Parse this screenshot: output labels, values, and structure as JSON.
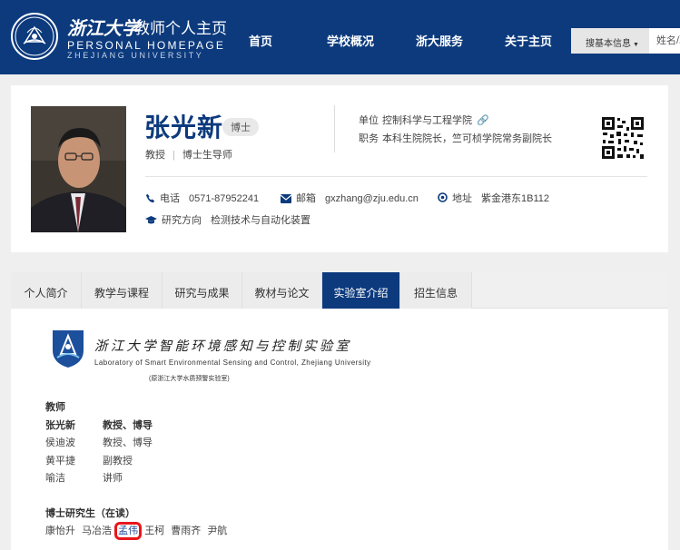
{
  "header": {
    "logo_cn": "浙江大学",
    "logo_title": "教师个人主页",
    "logo_en1": "PERSONAL HOMEPAGE",
    "logo_en2": "ZHEJIANG UNIVERSITY",
    "nav": [
      "首页",
      "学校概况",
      "浙大服务",
      "关于主页"
    ],
    "search_select": "搜基本信息",
    "search_placeholder": "姓名/职"
  },
  "profile": {
    "name": "张光新",
    "degree": "博士",
    "title": "教授",
    "supervisor": "博士生导师",
    "org_label": "单位",
    "org_value": "控制科学与工程学院",
    "duty_label": "职务",
    "duty_value": "本科生院院长，竺可桢学院常务副院长",
    "phone_label": "电话",
    "phone_value": "0571-87952241",
    "email_label": "邮箱",
    "email_value": "gxzhang@zju.edu.cn",
    "addr_label": "地址",
    "addr_value": "紫金港东1B112",
    "research_label": "研究方向",
    "research_value": "检测技术与自动化装置"
  },
  "tabs": [
    "个人简介",
    "教学与课程",
    "研究与成果",
    "教材与论文",
    "实验室介绍",
    "招生信息"
  ],
  "active_tab": "实验室介绍",
  "lab": {
    "name_cn": "浙江大学智能环境感知与控制实验室",
    "name_en": "Laboratory of Smart Environmental Sensing and Control, Zhejiang University",
    "subtitle": "(原浙江大学水质预警实验室)"
  },
  "teachers": {
    "heading": "教师",
    "rows": [
      {
        "name": "张光新",
        "title": "教授、博导"
      },
      {
        "name": "侯迪波",
        "title": "教授、博导"
      },
      {
        "name": "黄平捷",
        "title": "副教授"
      },
      {
        "name": "喻洁",
        "title": "讲师"
      }
    ]
  },
  "phd": {
    "heading": "博士研究生（在读）",
    "students": [
      "康怡升",
      "马冶浩",
      "孟伟",
      "王柯",
      "曹雨齐",
      "尹航"
    ],
    "highlighted": "孟伟"
  },
  "colors": {
    "brand": "#0c3a7d",
    "highlight_box": "#e8161b"
  }
}
